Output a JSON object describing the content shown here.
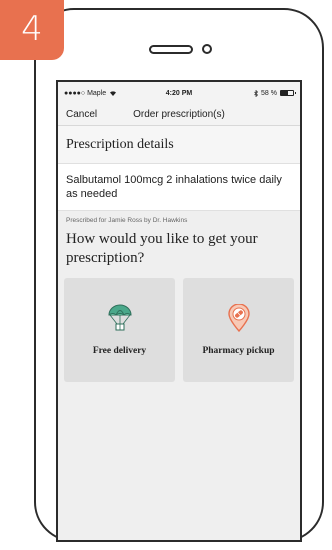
{
  "step_badge": "4",
  "status_bar": {
    "carrier": "●●●●○ Maple",
    "time": "4:20 PM",
    "battery": "58 %"
  },
  "nav": {
    "cancel_label": "Cancel",
    "title": "Order prescription(s)"
  },
  "prescription": {
    "section_title": "Prescription details",
    "details": "Salbutamol 100mcg 2 inhalations twice daily as needed",
    "prescribed_note": "Prescribed for Jamie Ross by Dr. Hawkins"
  },
  "question": "How would you like to get your prescription?",
  "options": [
    {
      "label": "Free delivery",
      "icon": "delivery-parachute-icon",
      "color": "#4aa88a"
    },
    {
      "label": "Pharmacy pickup",
      "icon": "location-pin-pill-icon",
      "color": "#e8714f"
    }
  ],
  "colors": {
    "accent": "#e8714f",
    "delivery_green": "#4aa88a",
    "card_bg": "#dedede"
  }
}
